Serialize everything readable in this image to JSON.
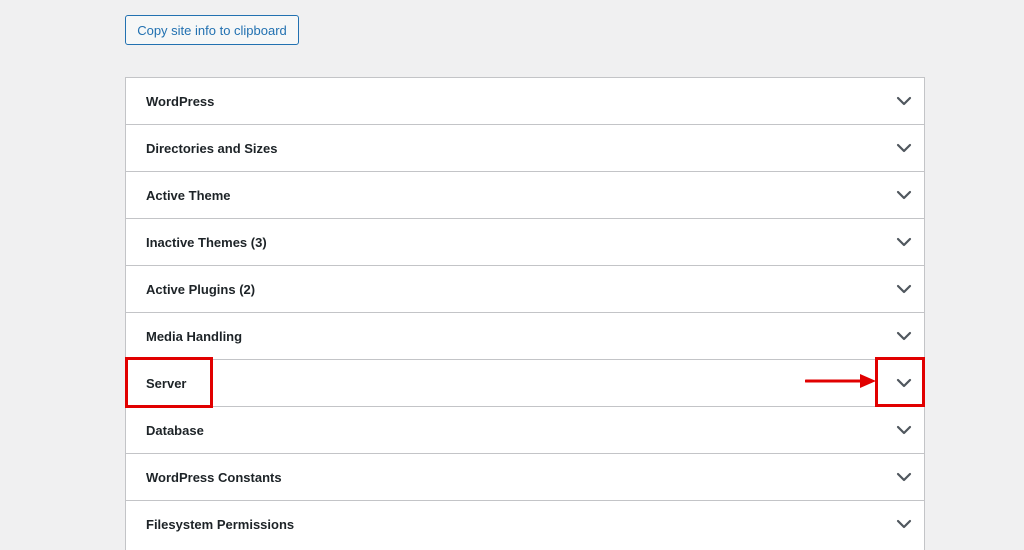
{
  "toolbar": {
    "copy_button_label": "Copy site info to clipboard"
  },
  "accordion": {
    "items": [
      {
        "label": "WordPress",
        "icon": "chevron-down-icon"
      },
      {
        "label": "Directories and Sizes",
        "icon": "chevron-down-icon"
      },
      {
        "label": "Active Theme",
        "icon": "chevron-down-icon"
      },
      {
        "label": "Inactive Themes (3)",
        "icon": "chevron-down-icon"
      },
      {
        "label": "Active Plugins (2)",
        "icon": "chevron-down-icon"
      },
      {
        "label": "Media Handling",
        "icon": "chevron-down-icon"
      },
      {
        "label": "Server",
        "icon": "chevron-down-icon"
      },
      {
        "label": "Database",
        "icon": "chevron-down-icon"
      },
      {
        "label": "WordPress Constants",
        "icon": "chevron-down-icon"
      },
      {
        "label": "Filesystem Permissions",
        "icon": "chevron-down-icon"
      }
    ]
  },
  "annotations": {
    "highlight_color": "#e10000",
    "arrow_icon": "right-arrow-icon"
  },
  "colors": {
    "background": "#f0f0f1",
    "panel": "#ffffff",
    "border": "#c3c4c7",
    "accent": "#2271b1",
    "text": "#1d2327"
  }
}
